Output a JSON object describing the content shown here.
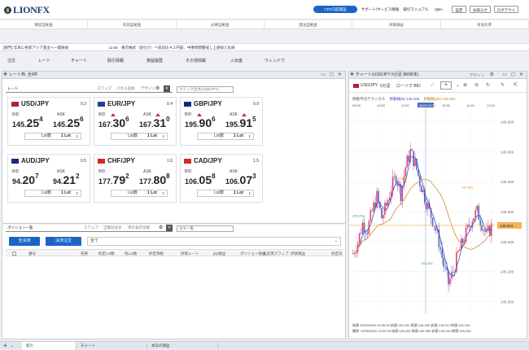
{
  "app": {
    "logo": "LIONFX"
  },
  "top": {
    "cfd": "CFD口座開設",
    "support": "サポート/サービス情報",
    "manual": "取引マニュアル",
    "qa": "Q&A",
    "settings": "設定",
    "notice": "お知らせ",
    "logout": "ログアウト"
  },
  "account": [
    "預託証拠金",
    "有効証拠金",
    "必要証拠金",
    "発注証拠金",
    "評価損益",
    "有効比率"
  ],
  "ticker": "[部門] 年末に各新アジア進出へ一関係統　　　　　　　　　　　11:55　東京株式（前引け）＝前日比４２円安、中東情勢警戒し上値抑え気味",
  "menu": [
    "注文",
    "レート",
    "チャート",
    "取引情報",
    "損益履歴",
    "その他情報",
    "入出金",
    "ウィンドウ"
  ],
  "rate": {
    "title": "レート枠, 全4件",
    "tab_rate": "レート",
    "tab_swap": "スワップ",
    "tab_panel": "パネル追加",
    "tab_design": "デザイン",
    "quick": "クイック注文(USD/JPY)",
    "tiles": [
      {
        "pair": "USD/JPY",
        "spread": "0.2",
        "bid": [
          "145.",
          "25",
          "4"
        ],
        "ask": [
          "145.",
          "25",
          "6"
        ],
        "color": "#b22234"
      },
      {
        "pair": "EUR/JPY",
        "spread": "0.4",
        "bid": [
          "167.",
          "30",
          "6"
        ],
        "ask": [
          "167.",
          "31",
          "0"
        ],
        "color": "#1d3f9a"
      },
      {
        "pair": "GBP/JPY",
        "spread": "0.9",
        "bid": [
          "195.",
          "90",
          "6"
        ],
        "ask": [
          "195.",
          "91",
          "5"
        ],
        "color": "#1a2a7a"
      },
      {
        "pair": "AUD/JPY",
        "spread": "0.5",
        "bid": [
          "94.",
          "20",
          "7"
        ],
        "ask": [
          "94.",
          "21",
          "2"
        ],
        "color": "#1a2a7a"
      },
      {
        "pair": "CHF/JPY",
        "spread": "1.6",
        "bid": [
          "177.",
          "79",
          "2"
        ],
        "ask": [
          "177.",
          "80",
          "8"
        ],
        "color": "#d52b1e"
      },
      {
        "pair": "CAD/JPY",
        "spread": "1.5",
        "bid": [
          "106.",
          "05",
          "8"
        ],
        "ask": [
          "106.",
          "07",
          "3"
        ],
        "color": "#d52b1e"
      }
    ],
    "bid_label": "BID",
    "ask_label": "ASK",
    "lot_label": "Lot数",
    "lot_value": "1 Lot",
    "lot_sub": "Lot単位\n1,000"
  },
  "position": {
    "title": "ポジション一覧",
    "tab_swap": "スワップ",
    "tab_all": "全無効注文",
    "tab_batch": "単計表示切替",
    "tab_order": "注文一覧",
    "close_all": "全決済",
    "close_order": "決済注文",
    "filter": "全て",
    "cols": [
      "番号",
      "売買",
      "約定Lot数",
      "残Lot数",
      "約定価格",
      "評価レート",
      "pip損益",
      "ポジション損益",
      "未実現スワップ",
      "評価損益",
      "約定日"
    ]
  },
  "chart": {
    "title": "チャート(USD/JPY 5分足 88/98本)",
    "design": "デザイン",
    "pair": "USD/JPY",
    "tf": "5分足",
    "candle": "ローソク BID",
    "legend_label": "移動平均テクニカル",
    "legend1": "移動線(5) 145.266",
    "legend2": "移動線(25) 145.294",
    "times": [
      "09:00",
      "10:00",
      "11:00",
      "06/20 09:55",
      "10:30",
      "11:00",
      "12:00"
    ],
    "yticks": [
      "145.600",
      "145.500",
      "145.400",
      "145.300",
      "145.200",
      "145.100",
      "145.000"
    ],
    "current": "145.254",
    "high": "145.386",
    "high2": "145.363",
    "low": "145.183",
    "low2": "145.243",
    "footer1": "始値 2025/06/20 09:30:00 始値:145.253 高値:145.269 安値:145.210 終値:145.254",
    "footer2": "最終: 2025/06/20 12:00:00 始値:145.253 高値:145.269 安値:145.254 終値:145.254"
  },
  "bottom": {
    "tabs": [
      "取引",
      "チャート",
      "本日の損益"
    ]
  }
}
